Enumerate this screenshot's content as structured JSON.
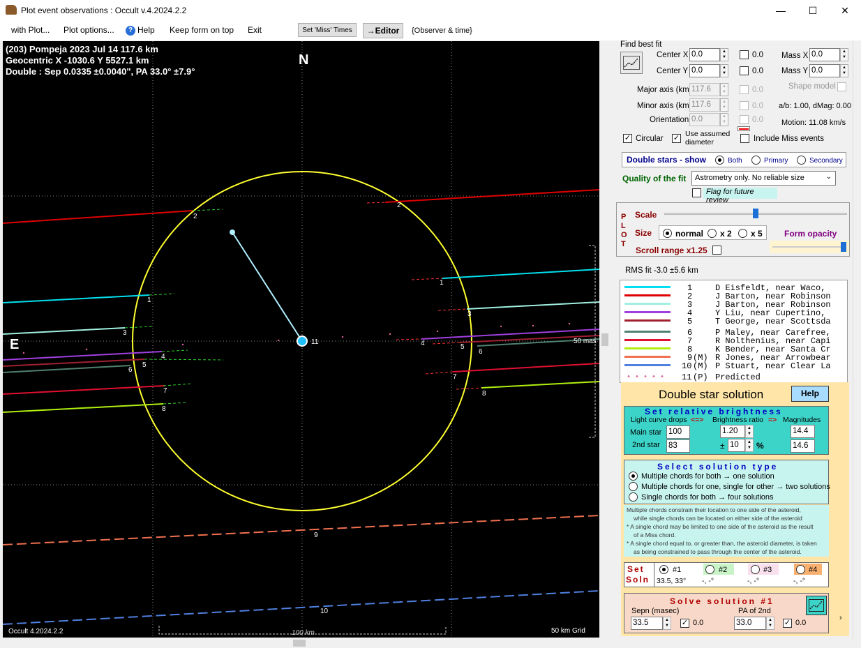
{
  "window": {
    "title": "Plot event observations : Occult v.4.2024.2.2",
    "minimize": "—",
    "maximize": "☐",
    "close": "✕"
  },
  "menu": {
    "items": [
      "with Plot...",
      "Plot options...",
      "Help",
      "Keep form on top",
      "Exit"
    ],
    "set_miss": "Set 'Miss' Times",
    "editor": "→Editor",
    "observer": "{Observer & time}"
  },
  "plot": {
    "line1": "(203) Pompeja  2023 Jul 14   117.6 km",
    "line2": "Geocentric  X  -1030.6  Y 5527.1 km",
    "line3": "Double : Sep  0.0335 ±0.0040\", PA 33.0° ±7.9°",
    "north": "N",
    "east": "E",
    "version": "Occult 4.2024.2.2",
    "scale_label": "100 km",
    "grid_label": "50 km Grid",
    "mas_label": "50 mas",
    "chord_numbers": [
      "1",
      "2",
      "3",
      "4",
      "5",
      "6",
      "7",
      "8",
      "9",
      "10",
      "11"
    ]
  },
  "fit": {
    "find_best_fit": "Find best fit",
    "center_x_label": "Center X",
    "center_x": "0.0",
    "center_x_cb": "0.0",
    "center_y_label": "Center Y",
    "center_y": "0.0",
    "center_y_cb": "0.0",
    "mass_x_label": "Mass X",
    "mass_x": "0.0",
    "mass_y_label": "Mass Y",
    "mass_y": "0.0",
    "major_label": "Major axis (km)",
    "major": "117.6",
    "major_cb": "0.0",
    "minor_label": "Minor axis (km)",
    "minor": "117.6",
    "minor_cb": "0.0",
    "orient_label": "Orientation",
    "orient": "0.0",
    "orient_cb": "0.0",
    "shape_model": "Shape model",
    "ab": "a/b: 1.00, dMag: 0.00",
    "motion": "Motion: 11.08 km/s",
    "circular": "Circular",
    "use_assumed": "Use assumed diameter",
    "include_miss": "Include Miss events",
    "double_show": "Double stars - show",
    "both": "Both",
    "primary": "Primary",
    "secondary": "Secondary",
    "quality_label": "Quality of the fit",
    "quality_value": "Astrometry only. No reliable size",
    "flag_review": "Flag for future review"
  },
  "plotbox": {
    "letters": [
      "P",
      "L",
      "O",
      "T"
    ],
    "scale": "Scale",
    "size": "Size",
    "normal": "normal",
    "x2": "x 2",
    "x5": "x 5",
    "form_opacity": "Form opacity",
    "scroll_range": "Scroll range x1.25",
    "scale_level": 0.5,
    "opacity_level": 0.98
  },
  "rms": "RMS fit -3.0 ±5.6 km",
  "legend": [
    {
      "num": "1",
      "tag": "",
      "name": "D Eisfeldt, near Waco,",
      "color": "#00e0f0"
    },
    {
      "num": "2",
      "tag": "",
      "name": "J Barton, near Robinson",
      "color": "#e00000"
    },
    {
      "num": "3",
      "tag": "",
      "name": "J Barton, near Robinson",
      "color": "#a0f0e0"
    },
    {
      "num": "4",
      "tag": "",
      "name": "Y Liu, near Cupertino,",
      "color": "#a040e0"
    },
    {
      "num": "5",
      "tag": "",
      "name": "T George, near Scottsda",
      "color": "#a02030"
    },
    {
      "num": "6",
      "tag": "",
      "name": "P Maley, near Carefree,",
      "color": "#508070"
    },
    {
      "num": "7",
      "tag": "",
      "name": "R Nolthenius, near Capi",
      "color": "#e01030"
    },
    {
      "num": "8",
      "tag": "",
      "name": "K Bender, near Santa Cr",
      "color": "#b0f010"
    },
    {
      "num": "9",
      "tag": "(M)",
      "name": "R Jones, near Arrowbear",
      "color": "#f07050"
    },
    {
      "num": "10",
      "tag": "(M)",
      "name": "P Stuart, near Clear La",
      "color": "#5080e0"
    },
    {
      "num": "11",
      "tag": "(P)",
      "name": "Predicted",
      "color": "#e060a0"
    }
  ],
  "double": {
    "title": "Double star solution",
    "help": "Help",
    "set_rel": "Set relative brightness",
    "lc_drops": "Light curve drops",
    "br_ratio": "Brightness ratio",
    "magnitudes": "Magnitudes",
    "arrow_lr": "<=>",
    "arrow_r": "=>",
    "main_star": "Main star",
    "main_val": "100",
    "ratio": "1.20",
    "mag1": "14.4",
    "second_star": "2nd star",
    "second_val": "83",
    "pm": "±",
    "pct_val": "10",
    "pct": "%",
    "mag2": "14.6",
    "select_type": "Select solution type",
    "opt1": "Multiple chords for both → one solution",
    "opt2": "Multiple chords for one, single for other → two solutions",
    "opt3": "Single chords for both → four solutions",
    "note1": "Multiple chords constrain their location to one side of the asteroid,",
    "note2": "while single chords can be located on either side of the asteroid",
    "note3": "* A single chord may be limited to one side of the asteroid as the result",
    "note4": "of a Miss chord.",
    "note5": "* A single chord equal to, or greater than, the asteroid diameter, is taken",
    "note6": "as being constrained to pass through the center of the asteroid.",
    "set": "Set",
    "soln": "Soln",
    "s1": "#1",
    "s2": "#2",
    "s3": "#3",
    "s4": "#4",
    "v1": "33.5, 33°",
    "v2": "-, -°",
    "v3": "-, -°",
    "v4": "-, -°",
    "solve": "Solve solution #1",
    "sepn_label": "Sepn (masec)",
    "sepn": "33.5",
    "sepn_cb": "0.0",
    "pa_label": "PA of 2nd",
    "pa": "33.0",
    "pa_cb": "0.0"
  },
  "colors": {
    "ellipse": "#ffff30",
    "axis_line": "#b0f0ff",
    "panel_teal": "#3cd4c8",
    "panel_cyan": "#c8f4f0",
    "salmon": "#f8d8c8"
  }
}
